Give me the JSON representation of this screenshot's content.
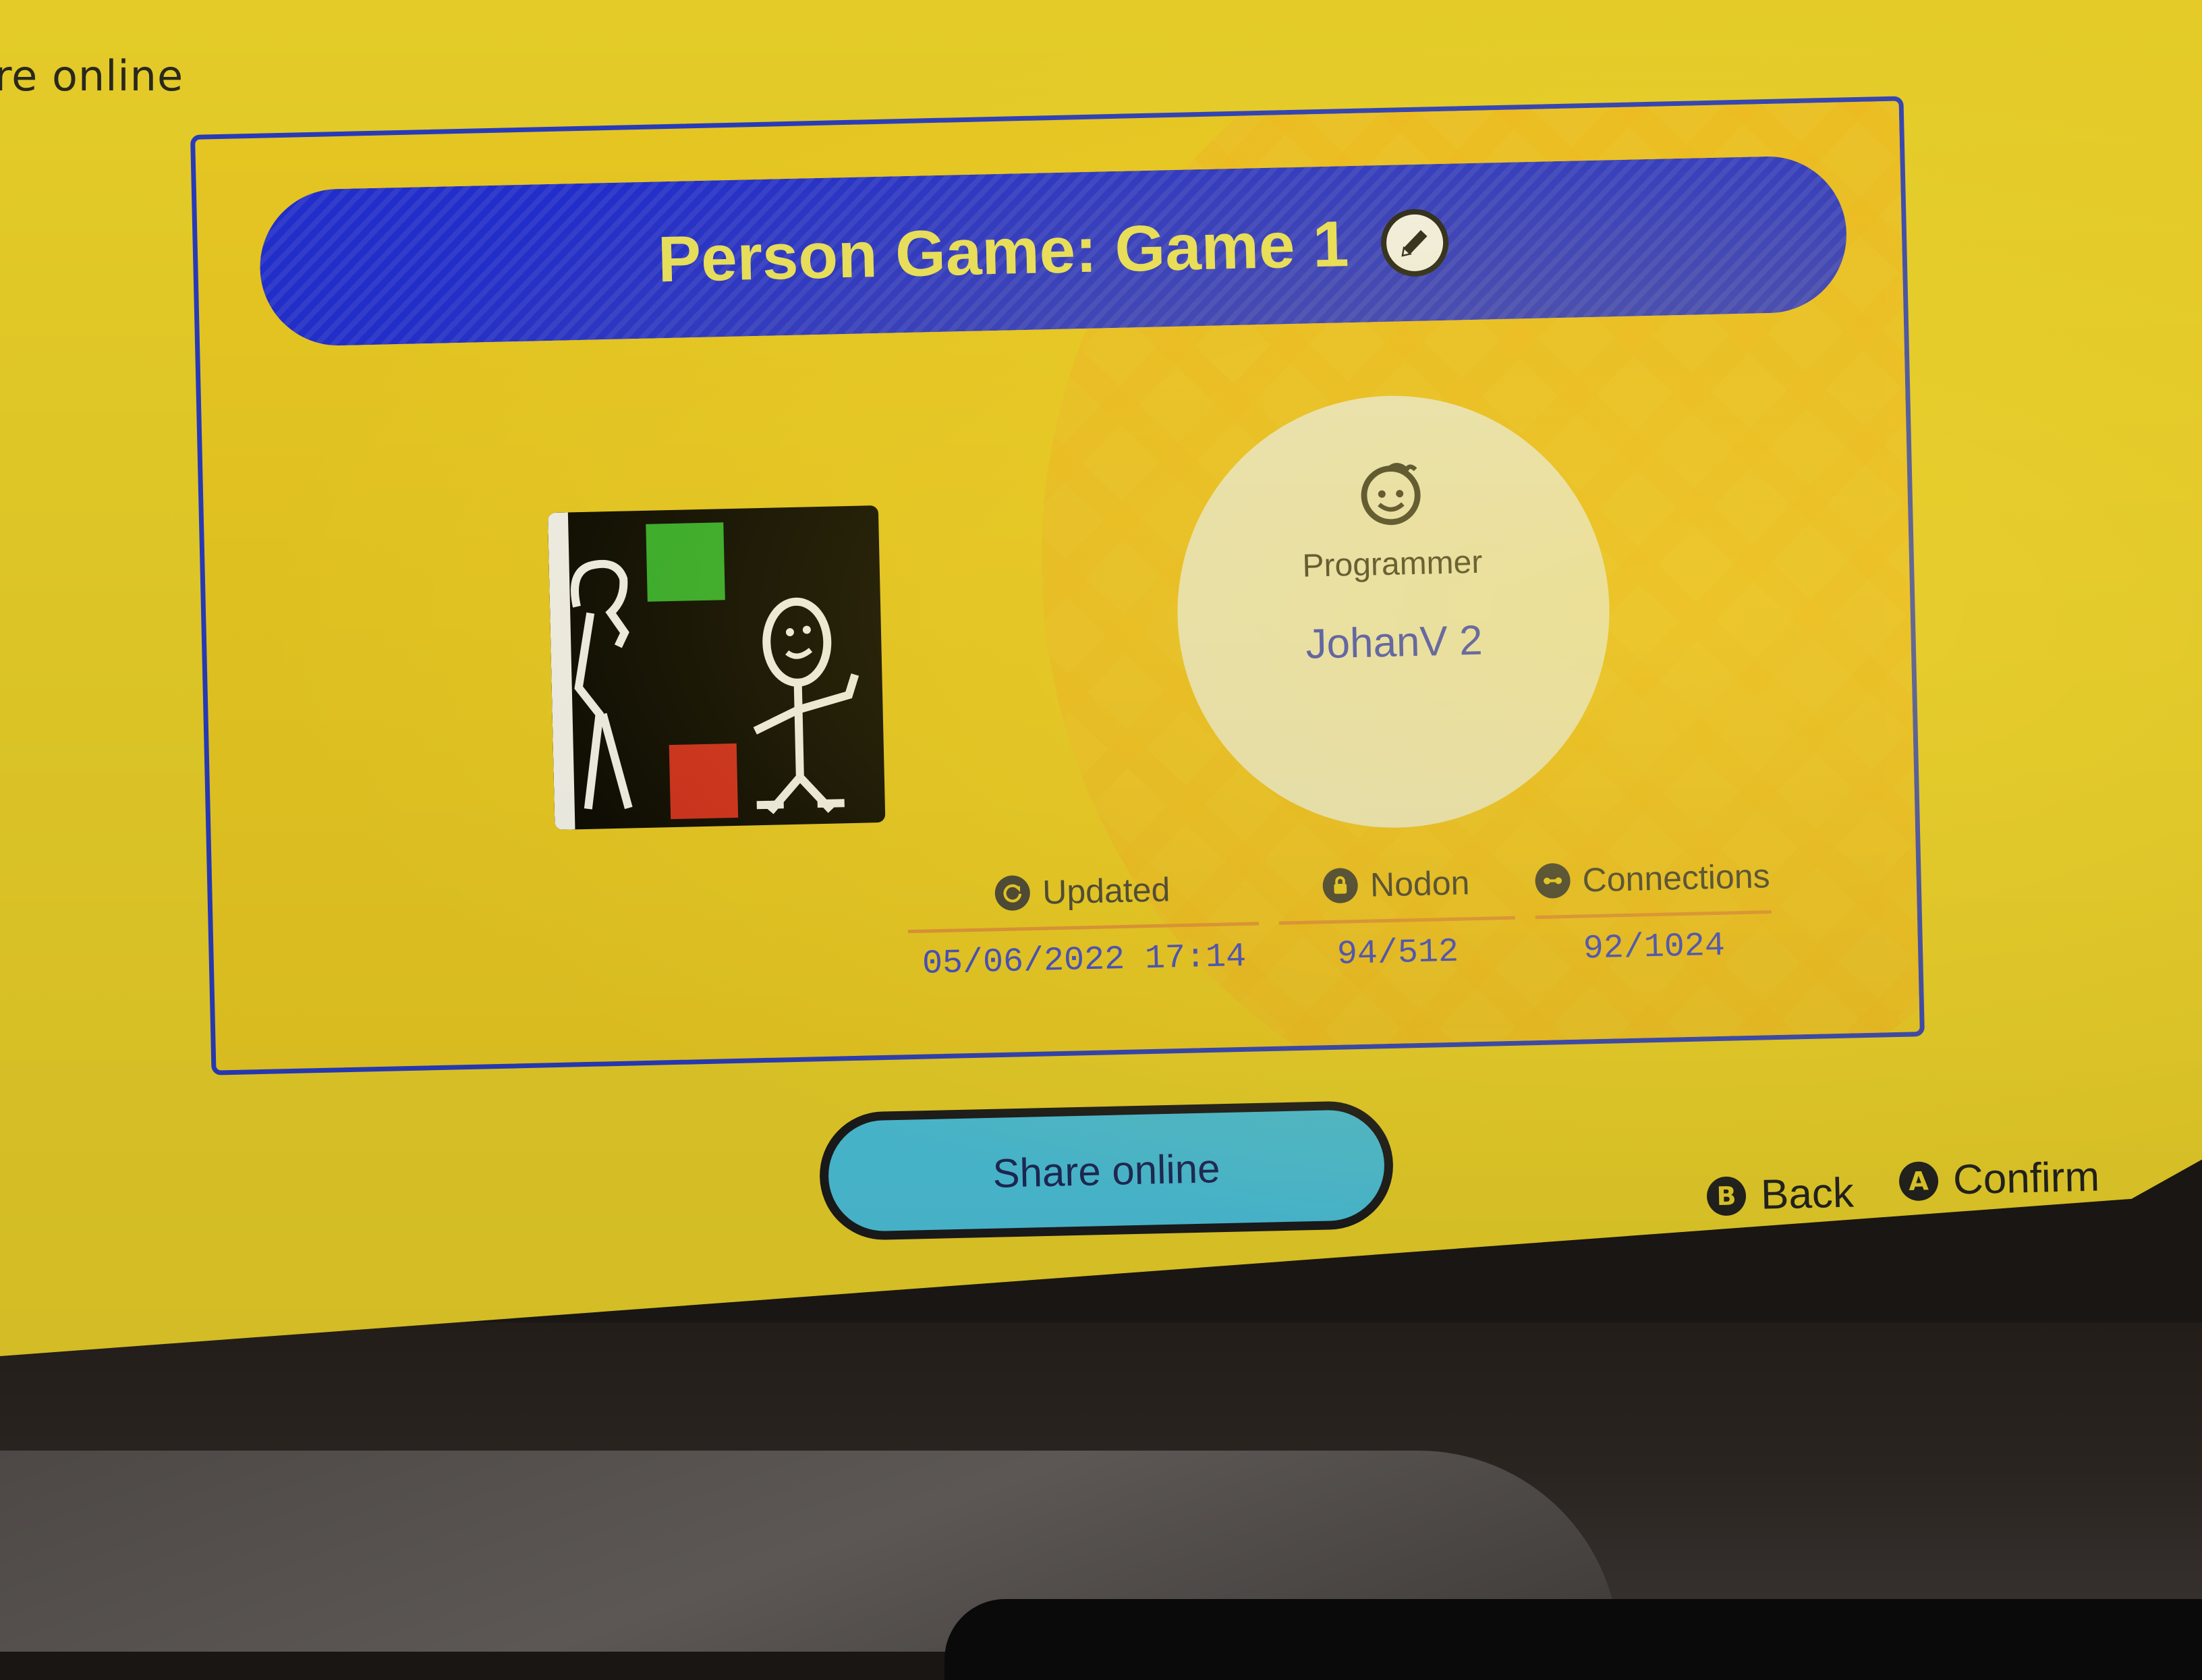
{
  "header": {
    "title": "re online"
  },
  "game": {
    "title": "Person Game: Game 1",
    "edit_icon": "pencil-icon"
  },
  "creator": {
    "icon": "smiley-face-icon",
    "label": "Programmer",
    "name": "JohanV 2"
  },
  "stats": {
    "updated": {
      "icon": "refresh-icon",
      "label": "Updated",
      "value": "05/06/2022 17:14"
    },
    "nodon": {
      "icon": "lock-icon",
      "label": "Nodon",
      "value": "94/512"
    },
    "connections": {
      "icon": "link-icon",
      "label": "Connections",
      "value": "92/1024"
    }
  },
  "actions": {
    "share_label": "Share online",
    "back": {
      "badge": "B",
      "label": "Back"
    },
    "confirm": {
      "badge": "A",
      "label": "Confirm"
    }
  },
  "colors": {
    "background": "#f0d62a",
    "banner": "#2431d6",
    "title_text": "#f5ec62",
    "value_text": "#3b47d4",
    "share_button": "#4fc8e0",
    "divider": "#e8953a"
  }
}
